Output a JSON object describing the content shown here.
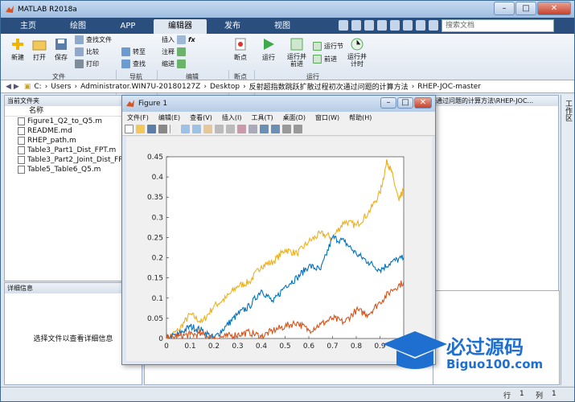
{
  "window": {
    "title": "MATLAB R2018a"
  },
  "tabs": [
    {
      "label": "主页"
    },
    {
      "label": "绘图"
    },
    {
      "label": "APP"
    },
    {
      "label": "编辑器"
    },
    {
      "label": "发布"
    },
    {
      "label": "视图"
    }
  ],
  "search": {
    "placeholder": "搜索文档"
  },
  "ribbon": {
    "new": "新建",
    "open": "打开",
    "save": "保存",
    "find_files": "查找文件",
    "compare": "比较",
    "print": "打印",
    "goto": "转至",
    "find": "查找",
    "insert": "插入",
    "fx": "fx",
    "comment": "注释",
    "indent": "缩进",
    "breakpoints": "断点",
    "run": "运行",
    "run_advance": "运行并\n前进",
    "run_section": "运行节",
    "advance": "前进",
    "run_time": "运行并\n计时",
    "groups": {
      "file": "文件",
      "nav": "导航",
      "edit": "编辑",
      "bp": "断点",
      "run": "运行"
    }
  },
  "address": {
    "segments": [
      "C:",
      "Users",
      "Administrator.WIN7U-20180127Z",
      "Desktop",
      "反射超指数跳跃扩散过程初次通过问题的计算方法",
      "RHEP-JOC-master"
    ]
  },
  "left_panel": {
    "header": "当前文件夹",
    "col_name": "名称",
    "files": [
      "Figure1_Q2_to_Q5.m",
      "README.md",
      "RHEP_path.m",
      "Table3_Part1_Dist_FPT.m",
      "Table3_Part2_Joint_Dist_FPT_T",
      "Table5_Table6_Q5.m"
    ]
  },
  "detail_panel": {
    "header": "详细信息",
    "message": "选择文件以查看详细信息"
  },
  "right_panel": {
    "path_text": "通过问题的计算方法\\RHEP-JOC..."
  },
  "sidebar": {
    "label": "工作区"
  },
  "status": {
    "line_label": "行",
    "line": "1",
    "col_label": "列",
    "col": "1"
  },
  "figure": {
    "title": "Figure 1",
    "menu": [
      "文件(F)",
      "编辑(E)",
      "查看(V)",
      "插入(I)",
      "工具(T)",
      "桌面(D)",
      "窗口(W)",
      "帮助(H)"
    ]
  },
  "colors": {
    "series1": "#0072bd",
    "series2": "#d95319",
    "series3": "#edb120"
  },
  "watermark": {
    "line1": "必过源码",
    "line2": "Biguo100.com"
  },
  "chart_data": {
    "type": "line",
    "xlim": [
      0,
      1
    ],
    "ylim": [
      0,
      0.45
    ],
    "xticks": [
      "0",
      "0.1",
      "0.2",
      "0.3",
      "0.4",
      "0.5",
      "0.6",
      "0.7",
      "0.8",
      "0.9",
      "1"
    ],
    "yticks": [
      "0",
      "0.05",
      "0.1",
      "0.15",
      "0.2",
      "0.25",
      "0.3",
      "0.35",
      "0.4",
      "0.45"
    ],
    "series": [
      {
        "color": "#edb120",
        "x": [
          0,
          0.05,
          0.1,
          0.15,
          0.2,
          0.25,
          0.3,
          0.35,
          0.4,
          0.45,
          0.5,
          0.55,
          0.6,
          0.65,
          0.7,
          0.75,
          0.8,
          0.85,
          0.9,
          0.93,
          0.95,
          0.98,
          1.0
        ],
        "y": [
          0.0,
          0.02,
          0.06,
          0.04,
          0.08,
          0.1,
          0.13,
          0.14,
          0.18,
          0.19,
          0.22,
          0.21,
          0.24,
          0.26,
          0.25,
          0.29,
          0.28,
          0.31,
          0.36,
          0.44,
          0.41,
          0.34,
          0.37
        ]
      },
      {
        "color": "#0072bd",
        "x": [
          0,
          0.05,
          0.1,
          0.15,
          0.2,
          0.25,
          0.3,
          0.35,
          0.4,
          0.45,
          0.5,
          0.55,
          0.6,
          0.65,
          0.7,
          0.75,
          0.8,
          0.85,
          0.9,
          0.95,
          1.0
        ],
        "y": [
          0.0,
          0.01,
          0.03,
          0.02,
          0.0,
          0.03,
          0.06,
          0.08,
          0.12,
          0.09,
          0.13,
          0.15,
          0.18,
          0.17,
          0.25,
          0.24,
          0.21,
          0.19,
          0.17,
          0.19,
          0.2
        ]
      },
      {
        "color": "#d95319",
        "x": [
          0,
          0.05,
          0.1,
          0.15,
          0.2,
          0.25,
          0.3,
          0.35,
          0.4,
          0.45,
          0.5,
          0.55,
          0.6,
          0.65,
          0.7,
          0.75,
          0.8,
          0.85,
          0.9,
          0.95,
          1.0
        ],
        "y": [
          0.0,
          0.005,
          0.01,
          0.01,
          0.0,
          0.005,
          0.01,
          0.015,
          0.005,
          0.02,
          0.03,
          0.04,
          0.02,
          0.035,
          0.05,
          0.04,
          0.07,
          0.06,
          0.09,
          0.12,
          0.14
        ]
      }
    ]
  }
}
